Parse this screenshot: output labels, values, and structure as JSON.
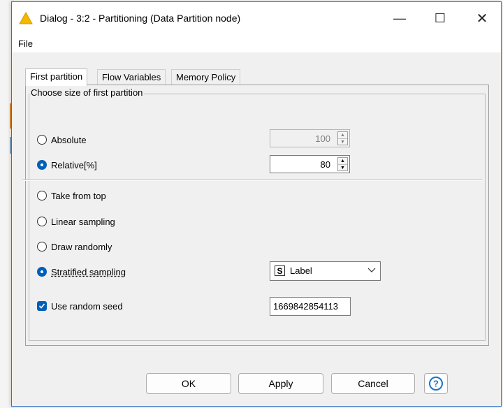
{
  "window": {
    "title": "Dialog - 3:2 - Partitioning (Data Partition node)",
    "controls": {
      "minimize": "—",
      "maximize": "☐",
      "close": "✕"
    },
    "warning_icon_color": "#f5b800"
  },
  "menu": {
    "file": "File"
  },
  "tabs": [
    {
      "label": "First partition",
      "active": true
    },
    {
      "label": "Flow Variables",
      "active": false
    },
    {
      "label": "Memory Policy",
      "active": false
    }
  ],
  "group": {
    "title": "Choose size of first partition"
  },
  "size_options": {
    "absolute": {
      "label": "Absolute",
      "checked": false,
      "value": "100",
      "disabled": true
    },
    "relative": {
      "label": "Relative[%]",
      "checked": true,
      "value": "80"
    }
  },
  "sampling_options": [
    {
      "label": "Take from top",
      "checked": false
    },
    {
      "label": "Linear sampling",
      "checked": false
    },
    {
      "label": "Draw randomly",
      "checked": false
    },
    {
      "label": "Stratified sampling",
      "checked": true
    }
  ],
  "stratified_column": {
    "type_badge": "S",
    "value": "Label"
  },
  "random_seed": {
    "label": "Use random seed",
    "checked": true,
    "value": "1669842854113"
  },
  "buttons": {
    "ok": "OK",
    "apply": "Apply",
    "cancel": "Cancel",
    "help": "?"
  },
  "colors": {
    "accent": "#005fb8",
    "window_border": "#2c74c6"
  }
}
